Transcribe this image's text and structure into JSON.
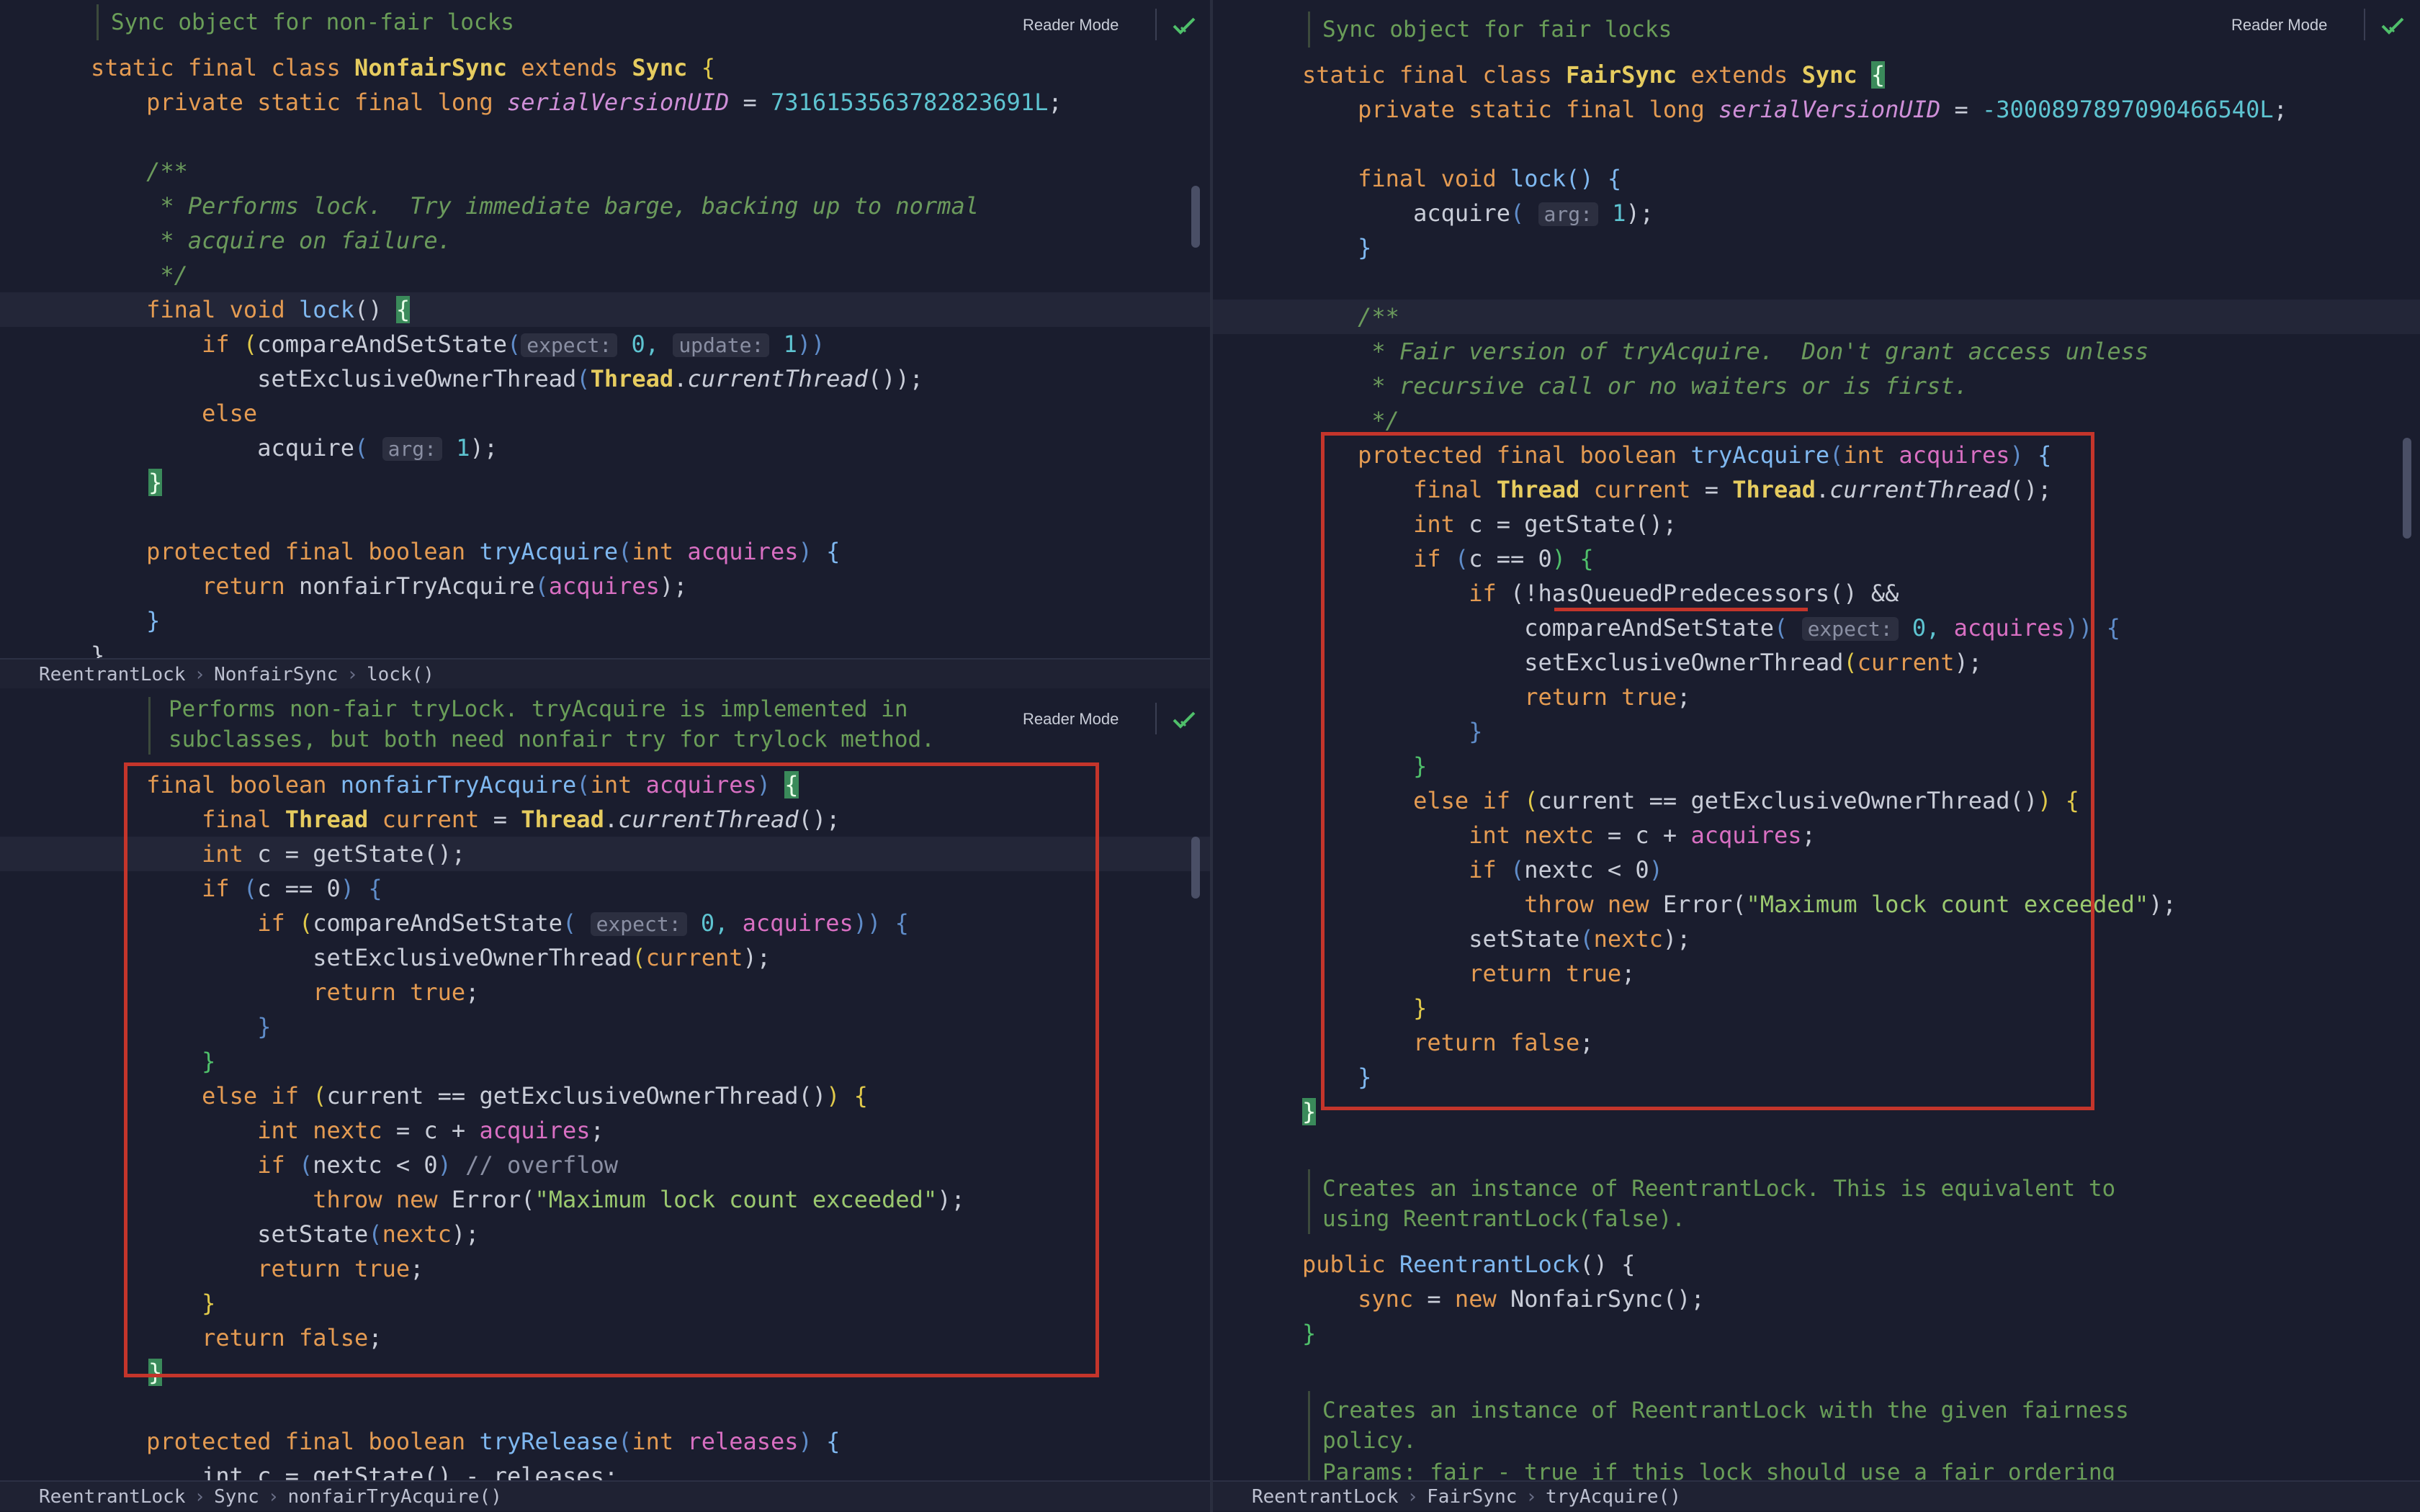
{
  "toolbar": {
    "reader_mode_label": "Reader Mode"
  },
  "top_left": {
    "doc_comment": "Sync object for non-fair locks",
    "class_decl": {
      "mods": "static final class ",
      "name": "NonfairSync",
      "extends_kw": " extends ",
      "parent": "Sync",
      "brace": " {"
    },
    "field": {
      "mods": "    private static final long ",
      "name": "serialVersionUID",
      "eq": " = ",
      "value": "7316153563782823691L",
      "end": ";"
    },
    "javadoc": [
      "    /**",
      "     * Performs lock.  Try immediate barge, backing up to normal",
      "     * acquire on failure.",
      "     */"
    ],
    "lock_decl": {
      "mods": "    final void ",
      "name": "lock",
      "parens": "() ",
      "brace": "{"
    },
    "if_line": {
      "kw": "        if ",
      "p1": "(",
      "call": "compareAndSetState",
      "p2": "(",
      "hint1": "expect:",
      "v1": " 0, ",
      "hint2": "update:",
      "v2": " 1",
      "p3": "))"
    },
    "set_owner_line": {
      "indent": "            ",
      "call": "setExclusiveOwnerThread",
      "p1": "(",
      "type": "Thread",
      "dot": ".",
      "meth": "currentThread",
      "rest": "());"
    },
    "else_line": "        else",
    "acquire_line": {
      "indent": "            ",
      "call": "acquire",
      "p1": "( ",
      "hint": "arg:",
      "v": " 1",
      "end": ");"
    },
    "close_brace": "}",
    "try_acquire_decl": {
      "mods": "    protected final boolean ",
      "name": "tryAcquire",
      "p1": "(",
      "type": "int ",
      "param": "acquires",
      "p2": ")",
      "brace": " {"
    },
    "return_line": {
      "kw": "        return ",
      "call": "nonfairTryAcquire",
      "p1": "(",
      "arg": "acquires",
      "p2": ");"
    },
    "close_brace2": "    }",
    "partial": "}"
  },
  "crumbs_top_left": [
    "ReentrantLock",
    "NonfairSync",
    "lock()"
  ],
  "bottom_left": {
    "doc_comment": [
      "Performs non-fair tryLock. tryAcquire is implemented in",
      "subclasses, but both need nonfair try for trylock method."
    ],
    "lines": {
      "decl": {
        "mods": "    final boolean ",
        "name": "nonfairTryAcquire",
        "p1": "(",
        "type": "int ",
        "param": "acquires",
        "p2": ") ",
        "brace": "{"
      },
      "cur": {
        "kw": "        final ",
        "type": "Thread",
        "var": " current",
        "eq": " = ",
        "type2": "Thread",
        "dot": ".",
        "meth": "currentThread",
        "rest": "();"
      },
      "c": {
        "kw": "        int ",
        "rest": "c = getState();"
      },
      "ifc": {
        "kw": "        if ",
        "p1": "(",
        "rest": "c == 0",
        "p2": ") {"
      },
      "ifcas": {
        "kw": "            if ",
        "p1": "(",
        "call": "compareAndSetState",
        "p2": "( ",
        "hint": "expect:",
        "v": " 0, ",
        "arg": "acquires",
        "p3": ")) {"
      },
      "setown": {
        "indent": "                ",
        "call": "setExclusiveOwnerThread",
        "p1": "(",
        "arg": "current",
        "p2": ");"
      },
      "rettrue": {
        "kw": "                return ",
        "val": "true",
        "end": ";"
      },
      "cb1": "            }",
      "cb2": "        }",
      "elseif": {
        "kw": "        else if ",
        "p1": "(",
        "rest": "current == getExclusiveOwnerThread()",
        "p2": ")",
        "brace": " {"
      },
      "nextc": {
        "kw": "            int ",
        "var": "nextc",
        "mid": " = c + ",
        "arg": "acquires",
        "end": ";"
      },
      "ifnext": {
        "kw": "            if ",
        "p1": "(",
        "rest": "nextc < 0",
        "p2": ") ",
        "cmt": "// overflow"
      },
      "throw": {
        "kw": "                throw new ",
        "cls": "Error",
        "p1": "(",
        "str": "\"Maximum lock count exceeded\"",
        "p2": ");"
      },
      "setstate": {
        "indent": "            ",
        "call": "setState",
        "p1": "(",
        "arg": "nextc",
        "p2": ");"
      },
      "rettrue2": {
        "kw": "            return ",
        "val": "true",
        "end": ";"
      },
      "cb3": "        }",
      "retfalse": {
        "kw": "        return ",
        "val": "false",
        "end": ";"
      },
      "close": "}",
      "tryrel": {
        "mods": "    protected final boolean ",
        "name": "tryRelease",
        "p1": "(",
        "type": "int ",
        "param": "releases",
        "p2": ")",
        "brace": " {"
      },
      "partial": "        int c = getState() - releases;"
    }
  },
  "crumbs_bottom_left": [
    "ReentrantLock",
    "Sync",
    "nonfairTryAcquire()"
  ],
  "right": {
    "doc_comment": "Sync object for fair locks",
    "class_decl": {
      "mods": "static final class ",
      "name": "FairSync",
      "extends_kw": " extends ",
      "parent": "Sync",
      "brace": "{"
    },
    "field": {
      "mods": "    private static final long ",
      "name": "serialVersionUID",
      "eq": " = ",
      "value": "-3000897897090466540L",
      "end": ";"
    },
    "lock_decl": {
      "mods": "    final void ",
      "name": "lock",
      "rest": "() {"
    },
    "acquire_line": {
      "indent": "        ",
      "call": "acquire",
      "p1": "( ",
      "hint": "arg:",
      "v": " 1",
      "end": ");"
    },
    "cb": "    }",
    "javadoc": [
      "    /**",
      "     * Fair version of tryAcquire.  Don't grant access unless",
      "     * recursive call or no waiters or is first.",
      "     */"
    ],
    "lines": {
      "decl": {
        "mods": "    protected final boolean ",
        "name": "tryAcquire",
        "p1": "(",
        "type": "int ",
        "param": "acquires",
        "p2": ")",
        "brace": " {"
      },
      "cur": {
        "kw": "        final ",
        "type": "Thread",
        "var": " current",
        "eq": " = ",
        "type2": "Thread",
        "dot": ".",
        "meth": "currentThread",
        "rest": "();"
      },
      "c": {
        "kw": "        int ",
        "rest": "c = getState();"
      },
      "ifc": {
        "kw": "        if ",
        "p1": "(",
        "rest": "c == 0",
        "p2": ") {"
      },
      "ifq": {
        "kw": "            if ",
        "p1": "(!",
        "call": "hasQueuedPredecessors",
        "rest": "() &&"
      },
      "cas": {
        "indent": "                ",
        "call": "compareAndSetState",
        "p1": "( ",
        "hint": "expect:",
        "v": " 0, ",
        "arg": "acquires",
        "p2": ")) {"
      },
      "setown": {
        "indent": "                ",
        "call": "setExclusiveOwnerThread",
        "p1": "(",
        "arg": "current",
        "p2": ");"
      },
      "rettrue": {
        "kw": "                return ",
        "val": "true",
        "end": ";"
      },
      "cb1": "            }",
      "cb2": "        }",
      "elseif": {
        "kw": "        else if ",
        "p1": "(",
        "rest": "current == getExclusiveOwnerThread()",
        "p2": ")",
        "brace": " {"
      },
      "nextc": {
        "kw": "            int ",
        "var": "nextc",
        "mid": " = c + ",
        "arg": "acquires",
        "end": ";"
      },
      "ifnext": {
        "kw": "            if ",
        "p1": "(",
        "rest": "nextc < 0",
        "p2": ")"
      },
      "throw": {
        "kw": "                throw new ",
        "cls": "Error",
        "p1": "(",
        "str": "\"Maximum lock count exceeded\"",
        "p2": ");"
      },
      "setstate": {
        "indent": "            ",
        "call": "setState",
        "p1": "(",
        "arg": "nextc",
        "p2": ");"
      },
      "rettrue2": {
        "kw": "            return ",
        "val": "true",
        "end": ";"
      },
      "cb3": "        }",
      "retfalse": {
        "kw": "        return ",
        "val": "false",
        "end": ";"
      },
      "cb4": "    }",
      "close": "}"
    },
    "ctor_doc": [
      "Creates an instance of ReentrantLock. This is equivalent to",
      "using ReentrantLock(false)."
    ],
    "ctor": {
      "kw": "public ",
      "name": "ReentrantLock",
      "rest": "() {"
    },
    "ctor_body": {
      "indent": "    ",
      "var": "sync",
      "eq": " = ",
      "kw": "new ",
      "rest": "NonfairSync();"
    },
    "ctor_close": "}",
    "ctor2_doc": [
      "Creates an instance of ReentrantLock with the given fairness",
      "policy."
    ],
    "ctor2_partial": "Params: fair - true if this lock should use a fair ordering"
  },
  "crumbs_right": [
    "ReentrantLock",
    "FairSync",
    "tryAcquire()"
  ]
}
